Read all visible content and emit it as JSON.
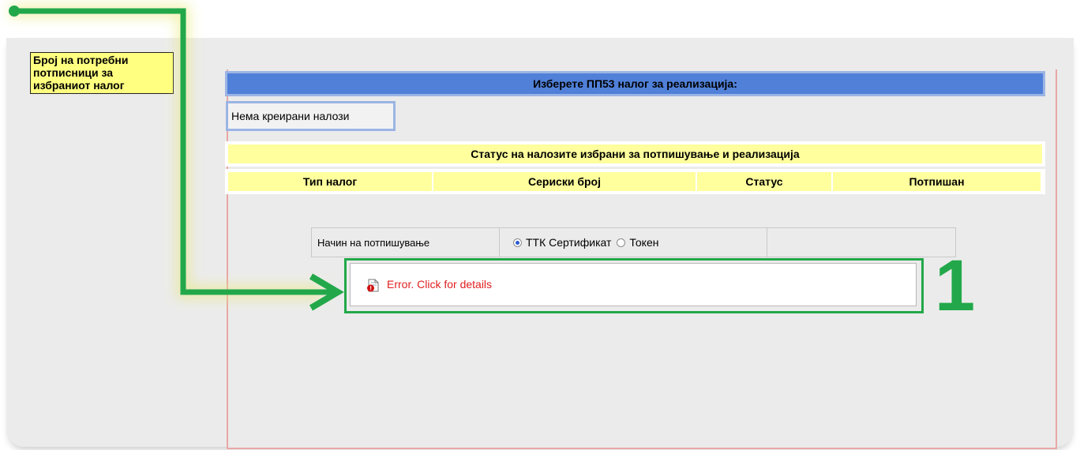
{
  "note": {
    "text": "Број на потребни потписници за избраниот налог"
  },
  "header": {
    "title": "Изберете ПП53 налог за реализација:"
  },
  "orders": {
    "empty_label": "Нема креирани налози"
  },
  "status_section": {
    "title": "Статус на налозите избрани за потпишување и реализација",
    "columns": [
      "Тип налог",
      "Сериски број",
      "Статус",
      "Потпишан"
    ]
  },
  "signing": {
    "label": "Начин на потпишување",
    "options": [
      {
        "label": "ТТК Сертификат",
        "checked": true
      },
      {
        "label": "Токен",
        "checked": false
      }
    ]
  },
  "error": {
    "text": "Error. Click for details"
  },
  "annotation": {
    "number": "1",
    "color": "#22a84a"
  }
}
